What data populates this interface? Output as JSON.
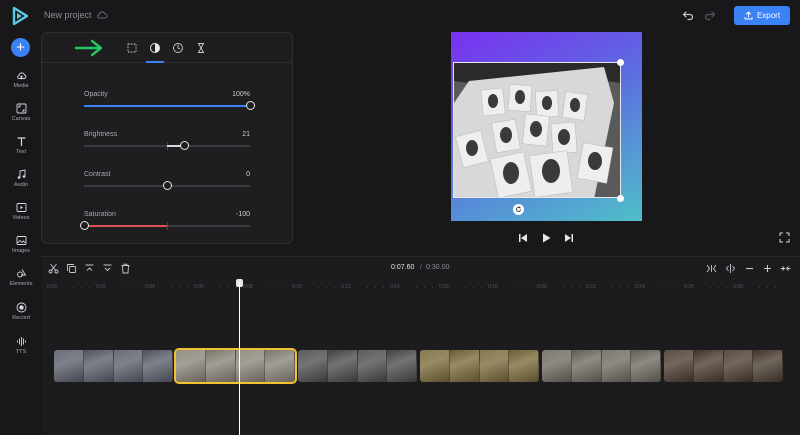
{
  "header": {
    "project_name": "New project",
    "export_label": "Export"
  },
  "sidebar": {
    "items": [
      {
        "label": "Media",
        "icon": "cloud-upload-icon"
      },
      {
        "label": "Canvas",
        "icon": "canvas-icon"
      },
      {
        "label": "Text",
        "icon": "text-icon"
      },
      {
        "label": "Audio",
        "icon": "music-note-icon"
      },
      {
        "label": "Videos",
        "icon": "video-icon"
      },
      {
        "label": "Images",
        "icon": "image-icon"
      },
      {
        "label": "Elements",
        "icon": "shapes-icon"
      },
      {
        "label": "Record",
        "icon": "record-icon"
      },
      {
        "label": "TTS",
        "icon": "waveform-icon"
      }
    ]
  },
  "panel": {
    "tabs": [
      "crop-icon",
      "adjust-icon",
      "speed-icon",
      "timer-icon"
    ],
    "active_tab": "adjust-icon",
    "sliders": [
      {
        "label": "Opacity",
        "value": "100%",
        "level": 1.0,
        "color": "#3b82f6",
        "centered": false
      },
      {
        "label": "Brightness",
        "value": "21",
        "level": 0.21,
        "color": "#d8d8dc",
        "centered": true
      },
      {
        "label": "Contrast",
        "value": "0",
        "level": 0.0,
        "color": "#d8d8dc",
        "centered": true
      },
      {
        "label": "Saturation",
        "value": "-100",
        "level": -1.0,
        "color": "#e05252",
        "centered": true
      }
    ]
  },
  "timeline": {
    "current_time": "0:07.60",
    "separator": "/",
    "total_time": "0:30.00",
    "ruler": [
      "0:00",
      "0:02",
      "0:04",
      "0:06",
      "0:08",
      "0:10",
      "0:12",
      "0:14",
      "0:16",
      "0:18",
      "0:20",
      "0:22",
      "0:24",
      "0:26",
      "0:28"
    ],
    "clips": [
      {
        "tone": "#5a5e6a",
        "selected": false
      },
      {
        "tone": "#8a8478",
        "selected": true
      },
      {
        "tone": "#4c4c4c",
        "selected": false
      },
      {
        "tone": "#7a6a3a",
        "selected": false
      },
      {
        "tone": "#6e6a60",
        "selected": false
      },
      {
        "tone": "#4a3c30",
        "selected": false
      }
    ]
  },
  "colors": {
    "accent": "#3b82f6",
    "arrow": "#22c55e",
    "selected_clip": "#f2c230"
  }
}
